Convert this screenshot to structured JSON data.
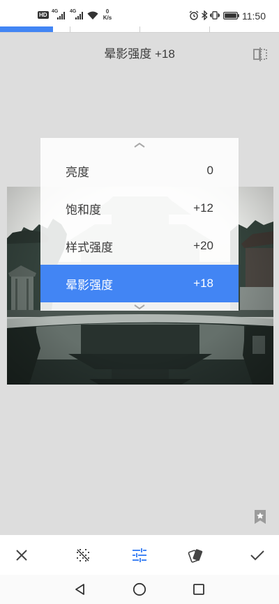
{
  "status_bar": {
    "hd_badge": "HD",
    "sim1_network": "4G",
    "sim2_network": "4G",
    "net_speed_value": "0",
    "net_speed_unit": "K/s",
    "time": "11:50",
    "icons": {
      "sim1_signal": "signal-icon",
      "sim2_signal": "signal-icon",
      "wifi": "wifi-icon",
      "alarm": "alarm-icon",
      "bluetooth": "bluetooth-icon",
      "vibrate": "vibrate-icon",
      "battery": "battery-icon"
    }
  },
  "progress_indicator": {
    "fill_fraction": 0.19
  },
  "header": {
    "title": "晕影强度 +18",
    "compare_icon": "compare-icon"
  },
  "adjust_menu": {
    "scroll_up_icon": "chevron-up-icon",
    "scroll_down_icon": "chevron-down-icon",
    "items": [
      {
        "label": "亮度",
        "value": "0",
        "selected": false
      },
      {
        "label": "饱和度",
        "value": "+12",
        "selected": false
      },
      {
        "label": "样式强度",
        "value": "+20",
        "selected": false
      },
      {
        "label": "晕影强度",
        "value": "+18",
        "selected": true
      }
    ]
  },
  "style_bookmark_icon": "bookmark-star-icon",
  "bottom_toolbar": {
    "items": [
      {
        "icon": "close-icon",
        "active": false
      },
      {
        "icon": "noise-icon",
        "active": false
      },
      {
        "icon": "tune-icon",
        "active": true
      },
      {
        "icon": "styles-icon",
        "active": false
      },
      {
        "icon": "check-icon",
        "active": false
      }
    ]
  },
  "nav_bar": {
    "icons": [
      "back-icon",
      "home-icon",
      "recents-icon"
    ]
  },
  "colors": {
    "accent": "#4285f4",
    "canvas_background": "#dddddd",
    "menu_text": "#3a3a3a"
  }
}
